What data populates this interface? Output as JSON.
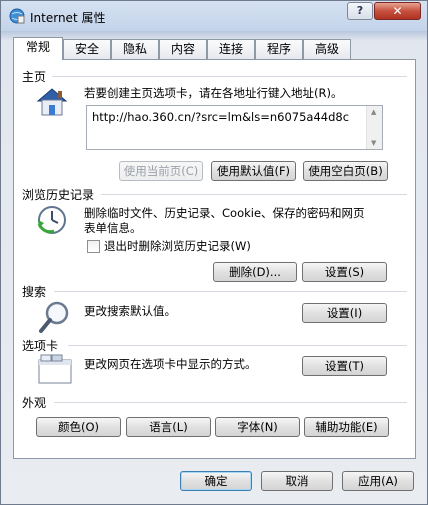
{
  "window": {
    "title": "Internet 属性",
    "help_glyph": "?",
    "close_glyph": "✕"
  },
  "tabs": [
    "常规",
    "安全",
    "隐私",
    "内容",
    "连接",
    "程序",
    "高级"
  ],
  "active_tab": "常规",
  "home": {
    "label": "主页",
    "description": "若要创建主页选项卡，请在各地址行键入地址(R)。",
    "url": "http://hao.360.cn/?src=lm&ls=n6075a44d8c",
    "btn_current": "使用当前页(C)",
    "btn_default": "使用默认值(F)",
    "btn_blank": "使用空白页(B)"
  },
  "history": {
    "label": "浏览历史记录",
    "description_line1": "删除临时文件、历史记录、Cookie、保存的密码和网页",
    "description_line2": "表单信息。",
    "checkbox_label": "退出时删除浏览历史记录(W)",
    "checkbox_checked": false,
    "btn_delete": "删除(D)...",
    "btn_settings": "设置(S)"
  },
  "search": {
    "label": "搜索",
    "description": "更改搜索默认值。",
    "btn_settings": "设置(I)"
  },
  "tabs_section": {
    "label": "选项卡",
    "description": "更改网页在选项卡中显示的方式。",
    "btn_settings": "设置(T)"
  },
  "appearance": {
    "label": "外观",
    "btn_colors": "颜色(O)",
    "btn_languages": "语言(L)",
    "btn_fonts": "字体(N)",
    "btn_accessibility": "辅助功能(E)"
  },
  "footer": {
    "ok": "确定",
    "cancel": "取消",
    "apply": "应用(A)"
  },
  "colors": {
    "window_border": "#6f7a8c",
    "close_red": "#c7503e",
    "panel_bg": "#ffffff"
  }
}
